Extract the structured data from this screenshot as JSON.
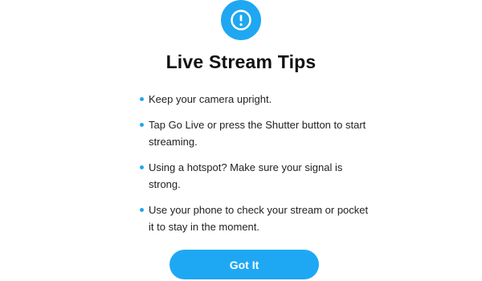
{
  "dialog": {
    "icon": "exclamation-alert-icon",
    "title": "Live Stream Tips",
    "tips": [
      "Keep your camera upright.",
      "Tap Go Live or press the Shutter button to start streaming.",
      "Using a hotspot? Make sure your signal is strong.",
      "Use your phone to check your stream or pocket it to stay in the moment."
    ],
    "button_label": "Got It"
  },
  "colors": {
    "accent": "#1fa7f2",
    "text": "#222222",
    "background": "#ffffff"
  }
}
